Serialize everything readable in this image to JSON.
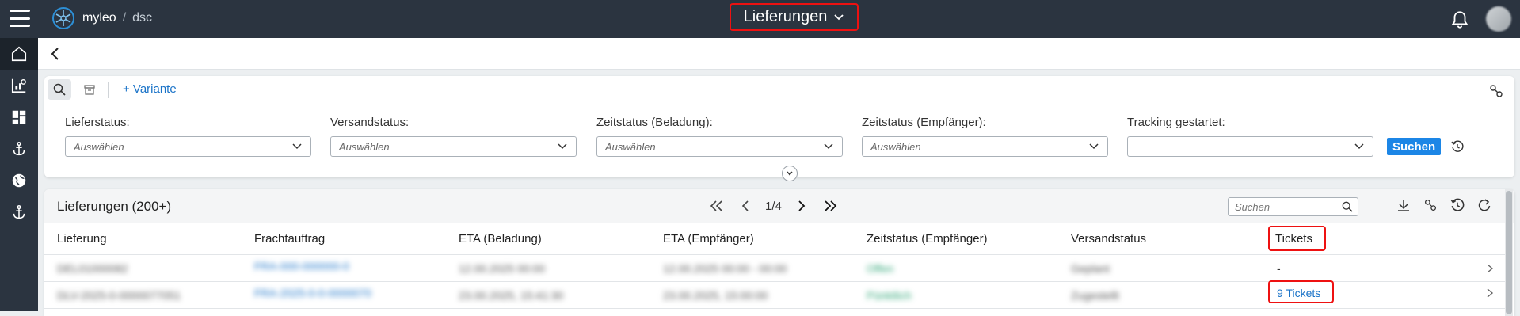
{
  "app": {
    "brand": "myleo",
    "brand_separator": "/",
    "brand_sub": "dsc"
  },
  "header": {
    "page_title": "Lieferungen"
  },
  "icons": {
    "menu": "hamburger-icon",
    "logo": "myleo-logo-icon",
    "bell": "bell-icon",
    "sidebar": [
      "home-icon",
      "chart-icon",
      "dashboard-icon",
      "anchor-icon",
      "globe-icon",
      "anchor-icon"
    ],
    "back": "chevron-left-icon"
  },
  "filters": {
    "variant_label": "+ Variante",
    "fields": [
      {
        "label": "Lieferstatus:",
        "placeholder": "Auswählen"
      },
      {
        "label": "Versandstatus:",
        "placeholder": "Auswählen"
      },
      {
        "label": "Zeitstatus (Beladung):",
        "placeholder": "Auswählen"
      },
      {
        "label": "Zeitstatus (Empfänger):",
        "placeholder": "Auswählen"
      },
      {
        "label": "Tracking gestartet:",
        "placeholder": ""
      }
    ],
    "search_button": "Suchen"
  },
  "list": {
    "title": "Lieferungen (200+)",
    "page_indicator": "1/4",
    "search_placeholder": "Suchen",
    "columns": [
      "Lieferung",
      "Frachtauftrag",
      "ETA (Beladung)",
      "ETA (Empfänger)",
      "Zeitstatus (Empfänger)",
      "Versandstatus",
      "Tickets"
    ],
    "rows": [
      {
        "lieferung": "DEL01000082",
        "frachtauftrag": "FRA-000-000000-0",
        "eta_beladung": "12.00.2025 00:00",
        "eta_empfaenger": "12.00.2025 00:00 - 00:00",
        "zeitstatus": "Offen",
        "versandstatus": "Geplant",
        "tickets": "-"
      },
      {
        "lieferung": "DLV-2025-0-0000077051",
        "frachtauftrag": "FRA-2025-0-0-0000070",
        "eta_beladung": "23.00.2025, 15:41:30",
        "eta_empfaenger": "23.00.2025, 15:00:00",
        "zeitstatus": "Pünktlich",
        "versandstatus": "Zugestellt",
        "tickets": "9 Tickets"
      }
    ]
  },
  "colors": {
    "topbar": "#2b3440",
    "accent": "#1c86e6",
    "link": "#1a73c8",
    "highlight": "#e11111"
  }
}
